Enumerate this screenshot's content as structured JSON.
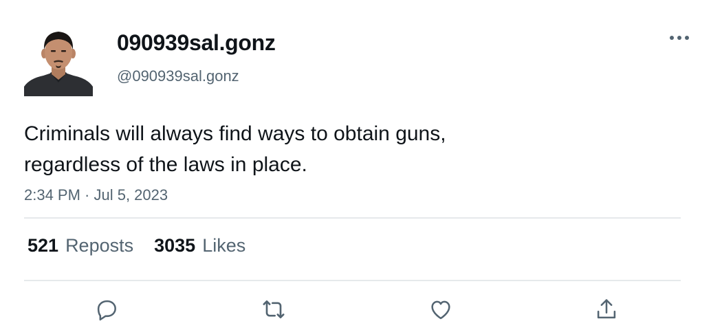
{
  "author": {
    "display_name": "090939sal.gonz",
    "handle": "@090939sal.gonz",
    "avatar_icon": "profile-photo"
  },
  "tweet": {
    "text_line_1": "Criminals will always find ways to obtain guns,",
    "text_line_2": "regardless of the laws in place.",
    "timestamp": "2:34 PM · Jul 5, 2023"
  },
  "stats": {
    "reposts_count": "521",
    "reposts_label": "Reposts",
    "likes_count": "3035",
    "likes_label": "Likes"
  },
  "actions": {
    "more_icon": "more-horizontal-icon",
    "reply_icon": "reply-icon",
    "repost_icon": "repost-icon",
    "like_icon": "like-icon",
    "share_icon": "share-icon"
  },
  "colors": {
    "text_primary": "#0f1419",
    "text_secondary": "#536471",
    "divider": "#e6e9eb"
  }
}
